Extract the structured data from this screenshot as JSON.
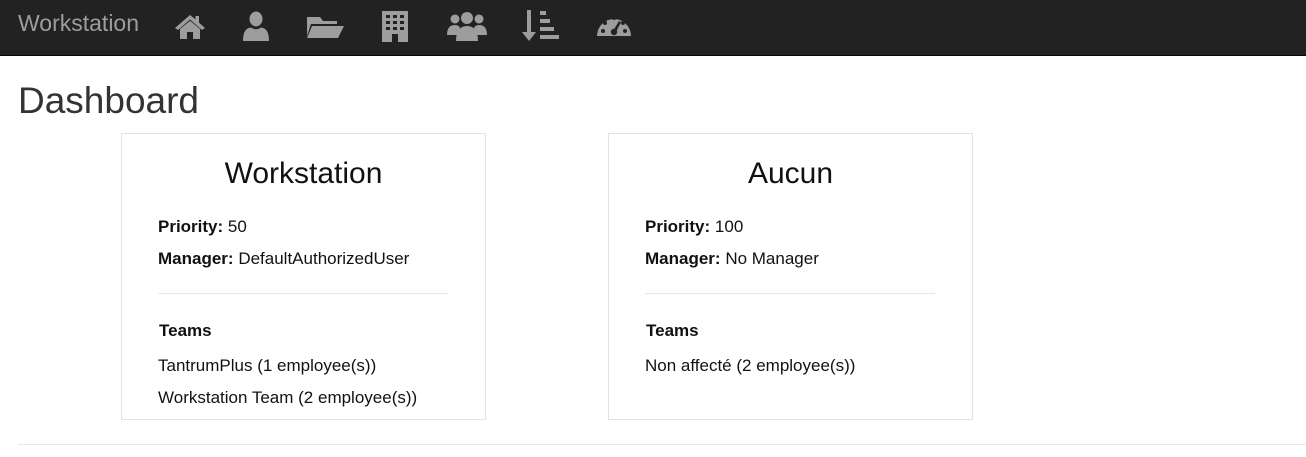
{
  "navbar": {
    "brand": "Workstation",
    "icons": [
      {
        "name": "home-icon"
      },
      {
        "name": "user-icon"
      },
      {
        "name": "folder-open-icon"
      },
      {
        "name": "building-icon"
      },
      {
        "name": "users-icon"
      },
      {
        "name": "sort-amount-icon"
      },
      {
        "name": "dashboard-gauge-icon"
      }
    ],
    "colors": {
      "background": "#222222",
      "icon": "#9d9d9d"
    }
  },
  "page": {
    "title": "Dashboard"
  },
  "cards": [
    {
      "title": "Workstation",
      "priority_label": "Priority:",
      "priority": "50",
      "manager_label": "Manager:",
      "manager": "DefaultAuthorizedUser",
      "teams_label": "Teams",
      "teams": [
        "TantrumPlus (1 employee(s))",
        "Workstation Team (2 employee(s))"
      ]
    },
    {
      "title": "Aucun",
      "priority_label": "Priority:",
      "priority": "100",
      "manager_label": "Manager:",
      "manager": "No Manager",
      "teams_label": "Teams",
      "teams": [
        "Non affecté (2 employee(s))"
      ]
    }
  ]
}
